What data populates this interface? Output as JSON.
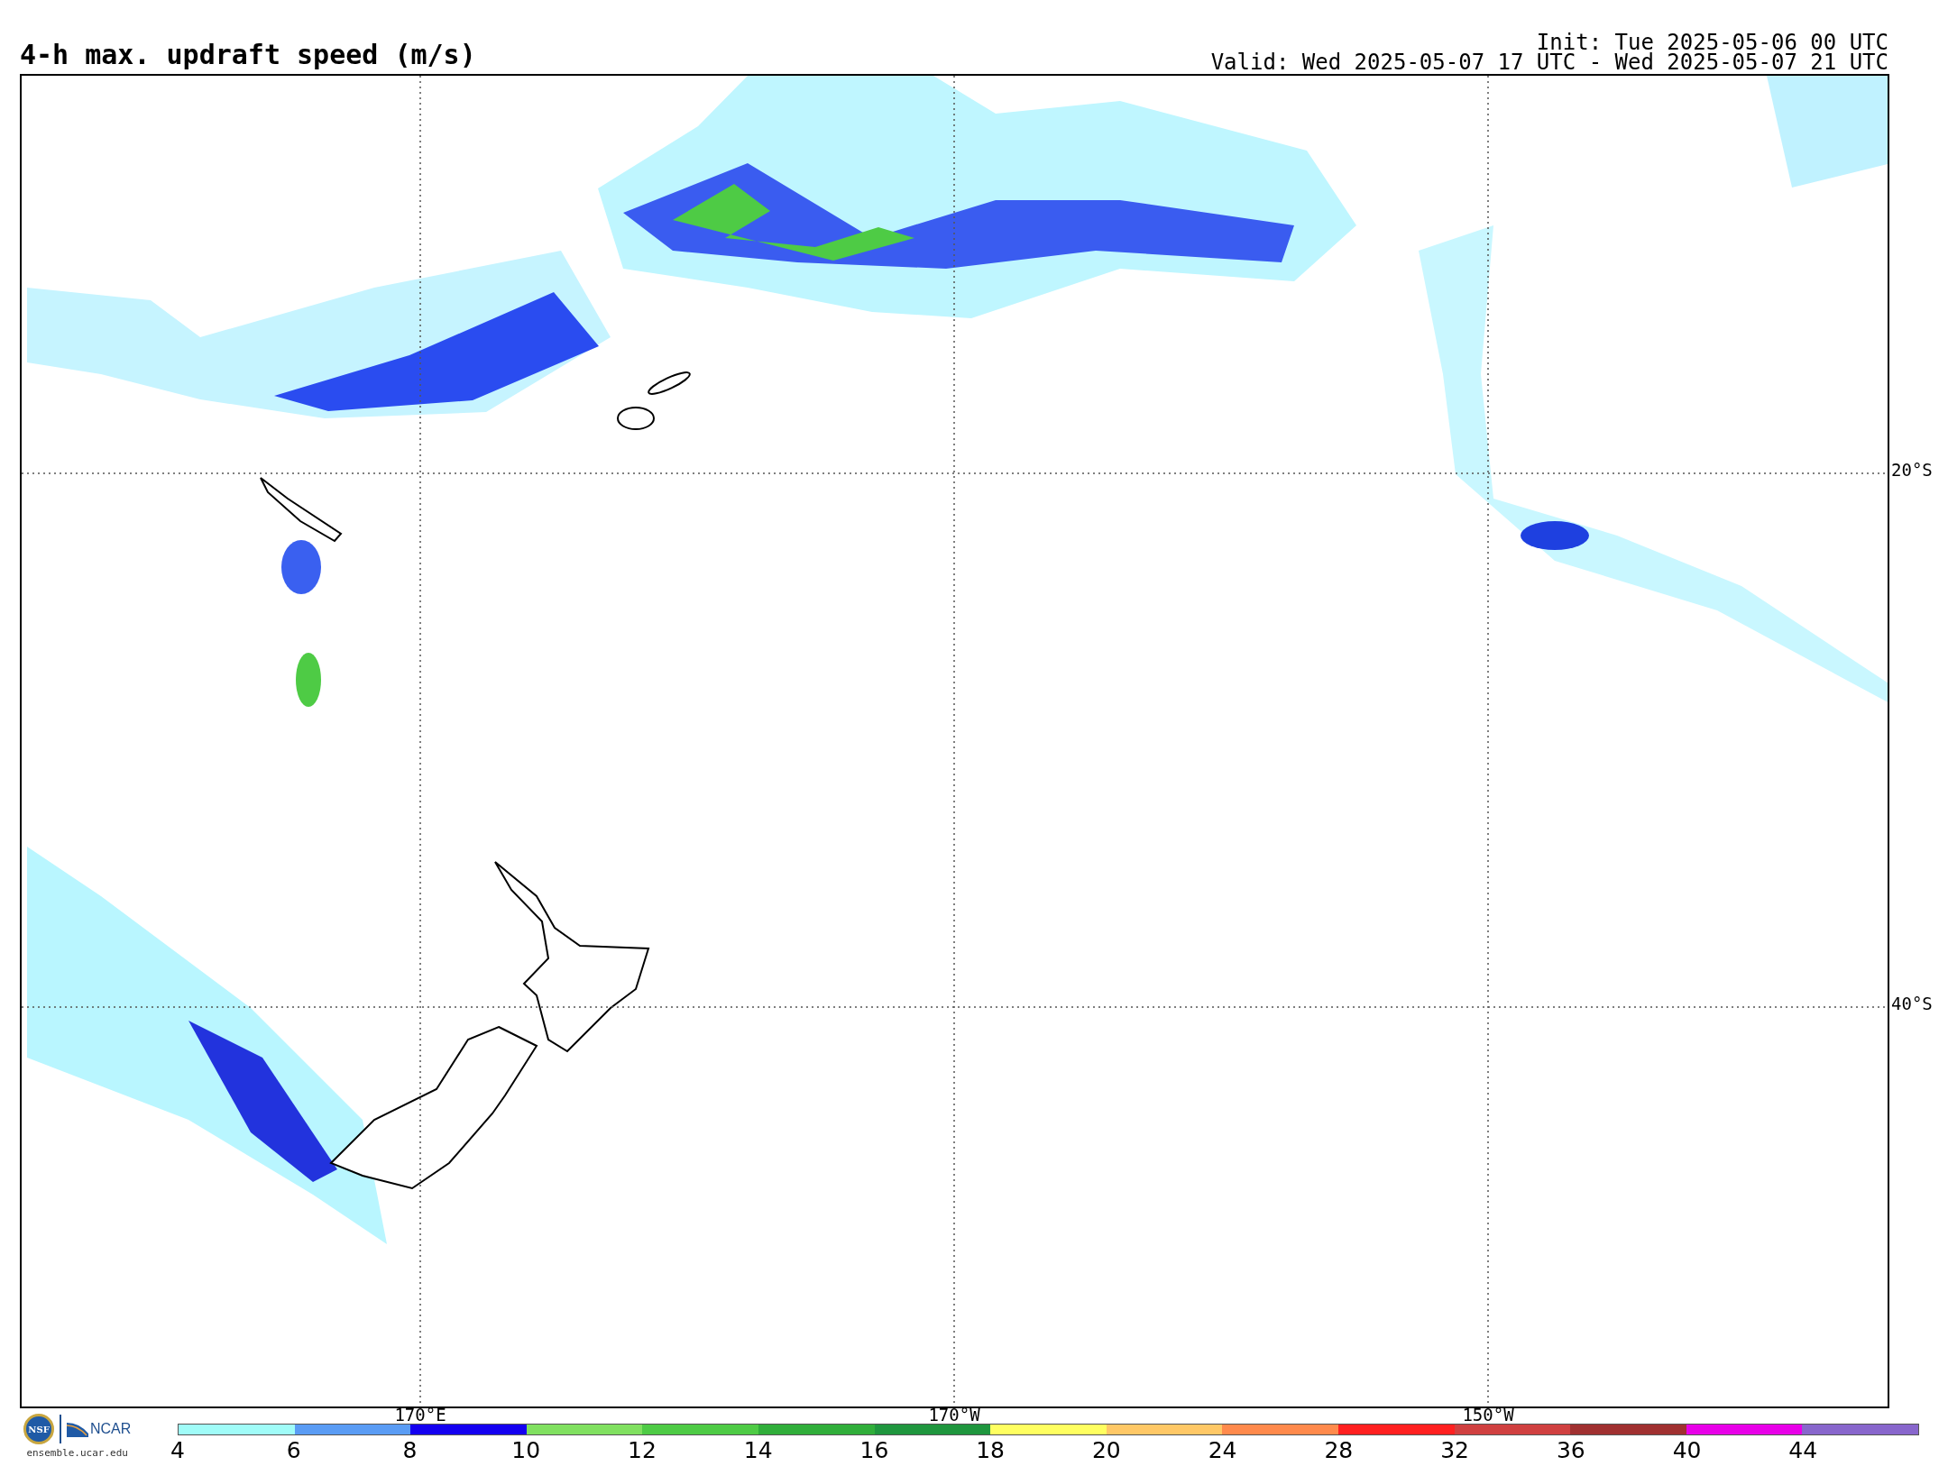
{
  "title": "4-h max. updraft speed (m/s)",
  "init": "Init: Tue 2025-05-06 00 UTC",
  "valid": "Valid: Wed 2025-05-07 17 UTC - Wed 2025-05-07 21 UTC",
  "map": {
    "latitude_labels": [
      "20°S",
      "40°S"
    ],
    "longitude_labels": [
      "170°E",
      "170°W",
      "150°W"
    ]
  },
  "logos": {
    "nsf": "NSF",
    "ncar": "NCAR",
    "url": "ensemble.ucar.edu"
  },
  "colorbar": {
    "bins": [
      {
        "color": "#a0fcf8"
      },
      {
        "color": "#5a9cf4"
      },
      {
        "color": "#1400f0"
      },
      {
        "color": "#80e060"
      },
      {
        "color": "#4ecb45"
      },
      {
        "color": "#30ae3a"
      },
      {
        "color": "#1f963e"
      },
      {
        "color": "#ffff60"
      },
      {
        "color": "#ffc866"
      },
      {
        "color": "#ff8a4c"
      },
      {
        "color": "#ff2020"
      },
      {
        "color": "#d04040"
      },
      {
        "color": "#a03030"
      },
      {
        "color": "#e800e8"
      },
      {
        "color": "#8866cc"
      }
    ],
    "ticks": [
      "4",
      "6",
      "8",
      "10",
      "12",
      "14",
      "16",
      "18",
      "20",
      "24",
      "28",
      "32",
      "36",
      "40",
      "44"
    ]
  }
}
